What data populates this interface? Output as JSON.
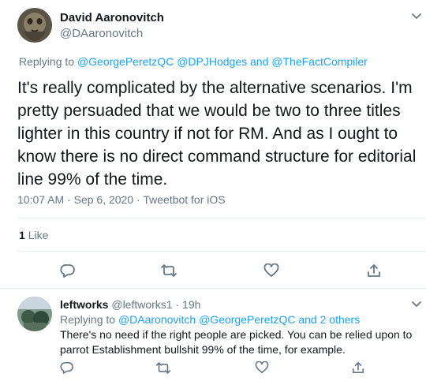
{
  "main_tweet": {
    "author_name": "David Aaronovitch",
    "author_handle": "@DAaronovitch",
    "replying_prefix": "Replying to",
    "replying_mentions": [
      "@GeorgePeretzQC",
      "@DPJHodges",
      "and",
      "@TheFactCompiler"
    ],
    "text_lines": [
      "It's really complicated by the alternative scenarios. I'm",
      "pretty persuaded that we would be two to three titles",
      "lighter in this country if not for RM. And as I ought to",
      "know there is no direct command structure  for editorial",
      "line 99% of the time."
    ],
    "time": "10:07 AM",
    "date": "Sep 6, 2020",
    "source": "Tweetbot for iOS",
    "likes_count": "1",
    "likes_label": "Like",
    "actions": [
      "reply-icon",
      "retweet-icon",
      "like-icon",
      "share-icon"
    ]
  },
  "reply_tweet": {
    "author_name": "leftworks",
    "author_handle": "@leftworks1",
    "age": "19h",
    "replying_prefix": "Replying to",
    "replying_mentions": [
      "@DAaronovitch",
      "@GeorgePeretzQC",
      "and",
      "2 others"
    ],
    "text_lines": [
      "There's no need if the right people are picked. You can be relied upon to",
      "parrot Establishment bullshit 99% of the time, for example."
    ],
    "actions": [
      "reply-icon",
      "retweet-icon",
      "like-icon",
      "share-icon"
    ]
  },
  "colors": {
    "link": "#1da1f2",
    "secondary_text": "#657786",
    "primary_text": "#14171a",
    "divider": "#e6ecf0"
  },
  "separator_dot": "·"
}
